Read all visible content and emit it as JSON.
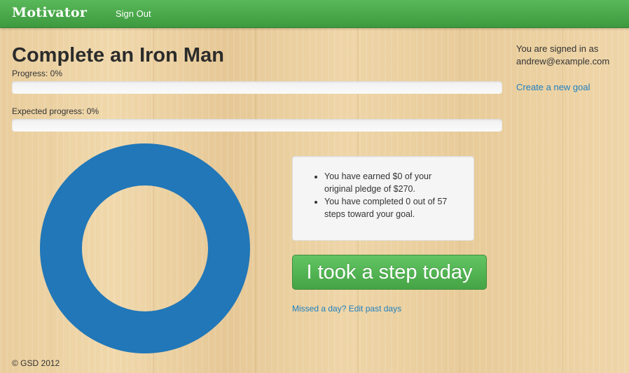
{
  "navbar": {
    "brand": "Motivator",
    "sign_out": "Sign Out",
    "bg_color": "#4caf50"
  },
  "goal": {
    "title": "Complete an Iron Man",
    "progress_label": "Progress: 0%",
    "progress_value": 0,
    "expected_label": "Expected progress: 0%",
    "expected_value": 0,
    "donut_color": "#2177b8"
  },
  "stats": {
    "earned": "You have earned $0 of your original pledge of $270.",
    "completed": "You have completed 0 out of 57 steps toward your goal."
  },
  "actions": {
    "step_button": "I took a step today",
    "missed_link": "Missed a day? Edit past days"
  },
  "sidebar": {
    "signed_in_prefix": "You are signed in as",
    "user_email": "andrew@example.com",
    "create_goal": "Create a new goal"
  },
  "footer": {
    "copyright": "© GSD 2012"
  }
}
